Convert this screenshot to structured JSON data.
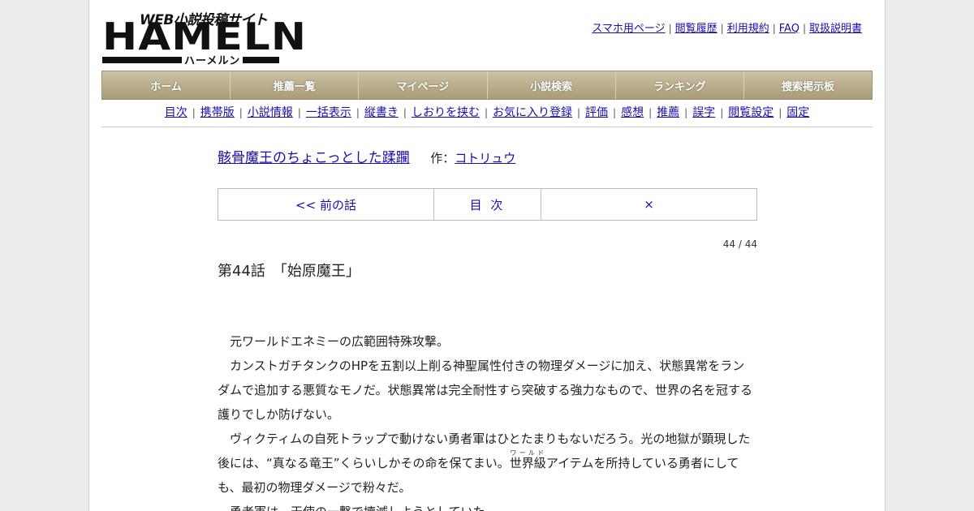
{
  "logo": {
    "tagline": "WEB小説投稿サイト",
    "wordmark": "HAMELN",
    "kana": "ハーメルン"
  },
  "top_links": [
    "スマホ用ページ",
    "閲覧履歴",
    "利用規約",
    "FAQ",
    "取扱説明書"
  ],
  "nav": [
    "ホーム",
    "推薦一覧",
    "マイページ",
    "小説検索",
    "ランキング",
    "捜索掲示板"
  ],
  "subnav": [
    "目次",
    "携帯版",
    "小説情報",
    "一括表示",
    "縦書き",
    "しおりを挟む",
    "お気に入り登録",
    "評価",
    "感想",
    "推薦",
    "誤字",
    "閲覧設定",
    "固定"
  ],
  "novel": {
    "title": "骸骨魔王のちょこっとした蹂躙",
    "author_label": "作：",
    "author": "コトリュウ"
  },
  "pager": {
    "prev": "<< 前の話",
    "toc": "目 次",
    "close": "×"
  },
  "page_count": "44 / 44",
  "chapter_title": "第44話　「始原魔王」",
  "body": {
    "p1": "元ワールドエネミーの広範囲特殊攻撃。",
    "p2": "カンストガチタンクのHPを五割以上削る神聖属性付きの物理ダメージに加え、状態異常をランダムで追加する悪質なモノだ。状態異常は完全耐性すら突破する強力なもので、世界の名を冠する護りでしか防げない。",
    "p3_a": "ヴィクティムの自死トラップで動けない勇者軍はひとたまりもないだろう。光の地獄が顕現した後には、“真なる竜王”くらいしかその命を保てまい。",
    "p3_ruby_base": "世界級",
    "p3_ruby_text": "ワールド",
    "p3_b": "アイテムを所持している勇者にしても、最初の物理ダメージで粉々だ。",
    "p4": "勇者軍は、天使の一撃で壊滅しようとしていた。"
  }
}
